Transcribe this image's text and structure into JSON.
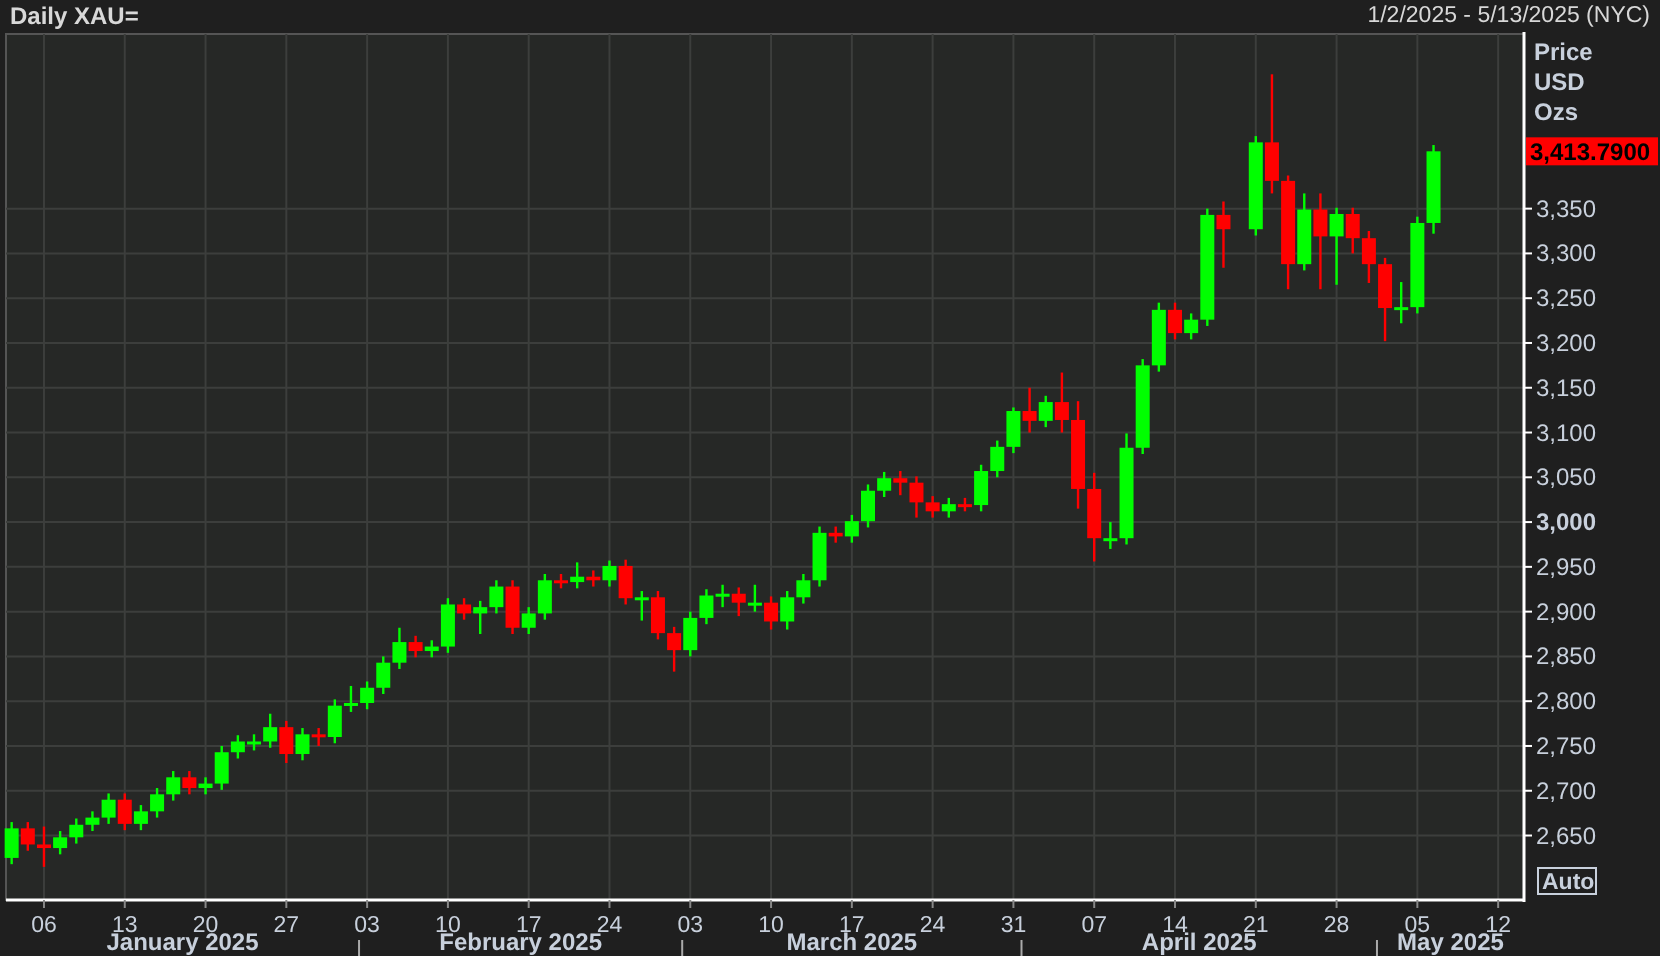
{
  "header": {
    "title": "Daily XAU=",
    "range": "1/2/2025 - 5/13/2025 (NYC)"
  },
  "axis_title": [
    "Price",
    "USD",
    "Ozs"
  ],
  "auto_button": {
    "label": "Auto"
  },
  "last_price": {
    "label": "3,413.7900"
  },
  "month_labels": [
    "January 2025",
    "February 2025",
    "March 2025",
    "April 2025",
    "May 2025"
  ],
  "chart_data": {
    "type": "candlestick",
    "grid": true,
    "ylim": [
      2578,
      3545
    ],
    "categories": [
      null,
      null,
      "06",
      null,
      null,
      null,
      null,
      "13",
      null,
      null,
      null,
      null,
      "20",
      null,
      null,
      null,
      null,
      "27",
      null,
      null,
      null,
      null,
      "03",
      null,
      null,
      null,
      null,
      "10",
      null,
      null,
      null,
      null,
      "17",
      null,
      null,
      null,
      null,
      "24",
      null,
      null,
      null,
      null,
      "03",
      null,
      null,
      null,
      null,
      "10",
      null,
      null,
      null,
      null,
      "17",
      null,
      null,
      null,
      null,
      "24",
      null,
      null,
      null,
      null,
      "31",
      null,
      null,
      null,
      null,
      "07",
      null,
      null,
      null,
      null,
      "14",
      null,
      null,
      null,
      null,
      "21",
      null,
      null,
      null,
      null,
      "28",
      null,
      null,
      null,
      null,
      "05",
      null,
      null,
      null,
      null,
      "12",
      null
    ],
    "ohlc": [
      [
        2625,
        2665,
        2618,
        2658
      ],
      [
        2658,
        2665,
        2633,
        2640
      ],
      [
        2640,
        2660,
        2615,
        2636
      ],
      [
        2636,
        2655,
        2629,
        2648
      ],
      [
        2648,
        2669,
        2641,
        2662
      ],
      [
        2662,
        2677,
        2655,
        2670
      ],
      [
        2670,
        2697,
        2663,
        2690
      ],
      [
        2690,
        2697,
        2656,
        2663
      ],
      [
        2663,
        2684,
        2656,
        2677
      ],
      [
        2677,
        2703,
        2670,
        2696
      ],
      [
        2696,
        2722,
        2689,
        2715
      ],
      [
        2715,
        2722,
        2696,
        2703
      ],
      [
        2703,
        2715,
        2696,
        2708
      ],
      [
        2708,
        2750,
        2701,
        2743
      ],
      [
        2743,
        2762,
        2736,
        2755
      ],
      [
        2755,
        2763,
        2745,
        2755
      ],
      [
        2755,
        2786,
        2748,
        2771
      ],
      [
        2771,
        2778,
        2731,
        2741
      ],
      [
        2741,
        2770,
        2734,
        2763
      ],
      [
        2763,
        2770,
        2750,
        2760
      ],
      [
        2760,
        2802,
        2753,
        2795
      ],
      [
        2795,
        2817,
        2788,
        2798
      ],
      [
        2798,
        2822,
        2791,
        2815
      ],
      [
        2815,
        2850,
        2808,
        2843
      ],
      [
        2843,
        2882,
        2836,
        2866
      ],
      [
        2866,
        2873,
        2849,
        2856
      ],
      [
        2856,
        2868,
        2849,
        2861
      ],
      [
        2861,
        2915,
        2854,
        2908
      ],
      [
        2908,
        2915,
        2891,
        2898
      ],
      [
        2898,
        2912,
        2875,
        2905
      ],
      [
        2905,
        2935,
        2898,
        2928
      ],
      [
        2928,
        2935,
        2875,
        2882
      ],
      [
        2882,
        2905,
        2875,
        2898
      ],
      [
        2898,
        2942,
        2891,
        2935
      ],
      [
        2935,
        2942,
        2926,
        2933
      ],
      [
        2933,
        2955,
        2926,
        2939
      ],
      [
        2939,
        2946,
        2928,
        2935
      ],
      [
        2935,
        2957,
        2928,
        2951
      ],
      [
        2951,
        2958,
        2908,
        2915
      ],
      [
        2915,
        2923,
        2890,
        2916
      ],
      [
        2916,
        2923,
        2869,
        2876
      ],
      [
        2876,
        2883,
        2833,
        2857
      ],
      [
        2857,
        2900,
        2850,
        2893
      ],
      [
        2893,
        2925,
        2886,
        2918
      ],
      [
        2918,
        2930,
        2905,
        2920
      ],
      [
        2920,
        2927,
        2895,
        2910
      ],
      [
        2910,
        2930,
        2900,
        2910
      ],
      [
        2910,
        2917,
        2880,
        2889
      ],
      [
        2889,
        2923,
        2880,
        2916
      ],
      [
        2916,
        2942,
        2909,
        2935
      ],
      [
        2935,
        2995,
        2928,
        2988
      ],
      [
        2988,
        2995,
        2977,
        2984
      ],
      [
        2984,
        3008,
        2977,
        3001
      ],
      [
        3001,
        3042,
        2994,
        3035
      ],
      [
        3035,
        3056,
        3028,
        3049
      ],
      [
        3049,
        3057,
        3030,
        3044
      ],
      [
        3044,
        3051,
        3005,
        3022
      ],
      [
        3022,
        3029,
        3005,
        3012
      ],
      [
        3012,
        3027,
        3005,
        3020
      ],
      [
        3020,
        3027,
        3012,
        3019
      ],
      [
        3019,
        3064,
        3012,
        3057
      ],
      [
        3057,
        3091,
        3050,
        3084
      ],
      [
        3084,
        3128,
        3077,
        3124
      ],
      [
        3124,
        3150,
        3100,
        3113
      ],
      [
        3113,
        3141,
        3106,
        3134
      ],
      [
        3134,
        3167,
        3100,
        3114
      ],
      [
        3114,
        3135,
        3015,
        3037
      ],
      [
        3037,
        3055,
        2956,
        2982
      ],
      [
        2982,
        3000,
        2970,
        2982
      ],
      [
        2982,
        3099,
        2975,
        3083
      ],
      [
        3083,
        3182,
        3076,
        3175
      ],
      [
        3175,
        3245,
        3168,
        3237
      ],
      [
        3237,
        3245,
        3204,
        3211
      ],
      [
        3211,
        3233,
        3204,
        3226
      ],
      [
        3226,
        3350,
        3219,
        3343
      ],
      [
        3343,
        3358,
        3284,
        3327
      ],
      null,
      [
        3327,
        3431,
        3320,
        3424
      ],
      [
        3424,
        3500,
        3367,
        3381
      ],
      [
        3381,
        3387,
        3260,
        3288
      ],
      [
        3288,
        3367,
        3281,
        3349
      ],
      [
        3349,
        3367,
        3260,
        3319
      ],
      [
        3319,
        3351,
        3265,
        3344
      ],
      [
        3344,
        3351,
        3300,
        3317
      ],
      [
        3317,
        3325,
        3267,
        3288
      ],
      [
        3288,
        3295,
        3202,
        3239
      ],
      [
        3239,
        3268,
        3222,
        3240
      ],
      [
        3240,
        3341,
        3233,
        3334
      ],
      [
        3334,
        3421,
        3322,
        3414
      ],
      null,
      null,
      null,
      null,
      null
    ],
    "yticks": [
      {
        "value": 2650,
        "label": "2,650"
      },
      {
        "value": 2700,
        "label": "2,700"
      },
      {
        "value": 2750,
        "label": "2,750"
      },
      {
        "value": 2800,
        "label": "2,800"
      },
      {
        "value": 2850,
        "label": "2,850"
      },
      {
        "value": 2900,
        "label": "2,900"
      },
      {
        "value": 2950,
        "label": "2,950"
      },
      {
        "value": 3000,
        "label": "3,000"
      },
      {
        "value": 3050,
        "label": "3,050"
      },
      {
        "value": 3100,
        "label": "3,100"
      },
      {
        "value": 3150,
        "label": "3,150"
      },
      {
        "value": 3200,
        "label": "3,200"
      },
      {
        "value": 3250,
        "label": "3,250"
      },
      {
        "value": 3300,
        "label": "3,300"
      },
      {
        "value": 3350,
        "label": "3,350"
      }
    ]
  }
}
